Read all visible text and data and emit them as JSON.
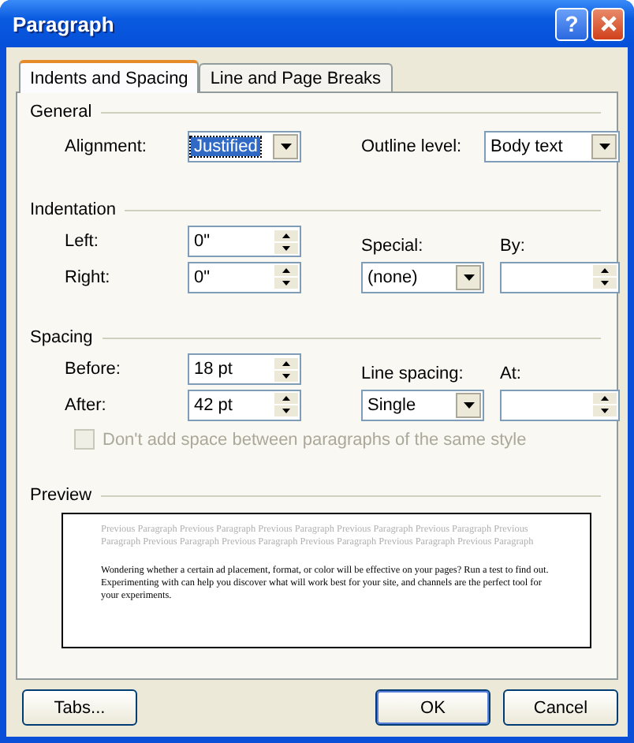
{
  "window": {
    "title": "Paragraph",
    "help_label": "?"
  },
  "tabs": [
    {
      "label": "Indents and Spacing",
      "selected": true
    },
    {
      "label": "Line and Page Breaks",
      "selected": false
    }
  ],
  "general": {
    "title": "General",
    "alignment": {
      "label": "Alignment:",
      "value": "Justified",
      "focused": true
    },
    "outline_level": {
      "label": "Outline level:",
      "value": "Body text",
      "focused": false
    }
  },
  "indentation": {
    "title": "Indentation",
    "left": {
      "label": "Left:",
      "value": "0\""
    },
    "right": {
      "label": "Right:",
      "value": "0\""
    },
    "special": {
      "label": "Special:",
      "value": "(none)",
      "focused": false
    },
    "by": {
      "label": "By:"
    }
  },
  "spacing": {
    "title": "Spacing",
    "before": {
      "label": "Before:",
      "value": "18 pt"
    },
    "after": {
      "label": "After:",
      "value": "42 pt"
    },
    "line_spacing": {
      "label": "Line spacing:",
      "value": "Single",
      "focused": false
    },
    "at": {
      "label": "At:"
    },
    "same_style": {
      "label": "Don't add space between paragraphs of the same style",
      "checked": false,
      "disabled": true
    }
  },
  "preview": {
    "title": "Preview",
    "previous_text": "Previous Paragraph Previous Paragraph Previous Paragraph Previous Paragraph Previous Paragraph Previous Paragraph Previous Paragraph Previous Paragraph Previous Paragraph Previous Paragraph Previous Paragraph",
    "sample_text": "Wondering whether a certain ad placement, format, or color will be effective on your pages? Run a test to find out. Experimenting with can help you discover what will work best for your site, and channels are the perfect tool for your experiments."
  },
  "buttons": [
    {
      "label": "Tabs...",
      "default": false
    },
    {
      "label": "OK",
      "default": true
    },
    {
      "label": "Cancel",
      "default": false
    }
  ]
}
